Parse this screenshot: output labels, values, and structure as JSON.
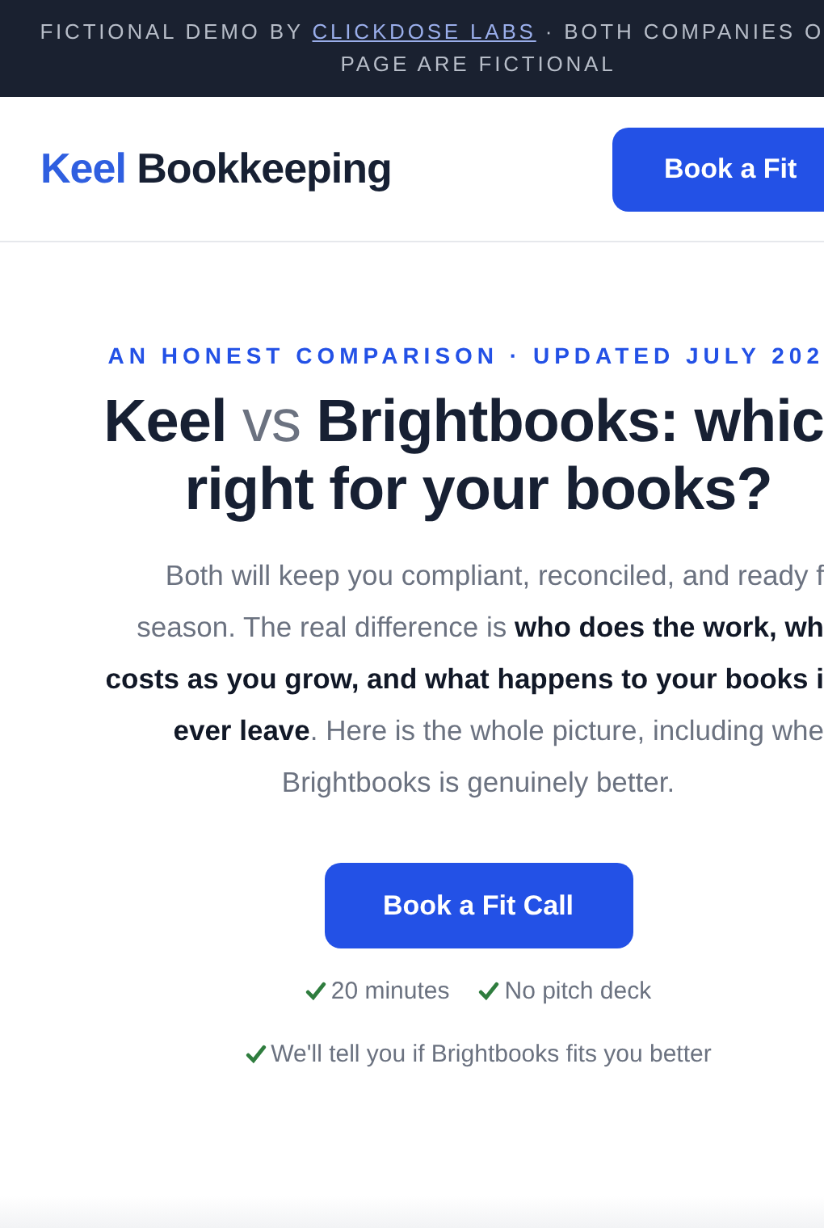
{
  "banner": {
    "before_link": "FICTIONAL DEMO BY ",
    "link": "CLICKDOSE LABS",
    "after_link": " · BOTH COMPANIES O",
    "second_line": "PAGE ARE FICTIONAL"
  },
  "header": {
    "logo_accent": "Keel",
    "logo_rest": "Bookkeeping",
    "button": "Book a Fit"
  },
  "hero": {
    "eyebrow": "AN HONEST COMPARISON · UPDATED JULY 202",
    "heading_lines": [
      {
        "clipped": true,
        "parts": [
          {
            "text": "Keel ",
            "muted": false
          },
          {
            "text": "vs",
            "muted": true
          },
          {
            "text": " Brightbooks: whic",
            "muted": false
          }
        ]
      },
      {
        "clipped": false,
        "parts": [
          {
            "text": "right for your books?",
            "muted": false
          }
        ]
      }
    ],
    "paragraph_lines": [
      {
        "clipped": true,
        "text": "Both will keep you compliant, reconciled, and ready f"
      },
      {
        "clipped": true,
        "text": "season. The real difference is **who does the work, wh**"
      },
      {
        "clipped": true,
        "text": "**costs as you grow, and what happens to your books i**"
      },
      {
        "clipped": true,
        "text": "**ever leave**. Here is the whole picture, including whe"
      },
      {
        "clipped": false,
        "text": "Brightbooks is genuinely better."
      }
    ],
    "cta": "Book a Fit Call",
    "checks": [
      "20 minutes",
      "No pitch deck"
    ],
    "note": "We'll tell you if Brightbooks fits you better"
  }
}
